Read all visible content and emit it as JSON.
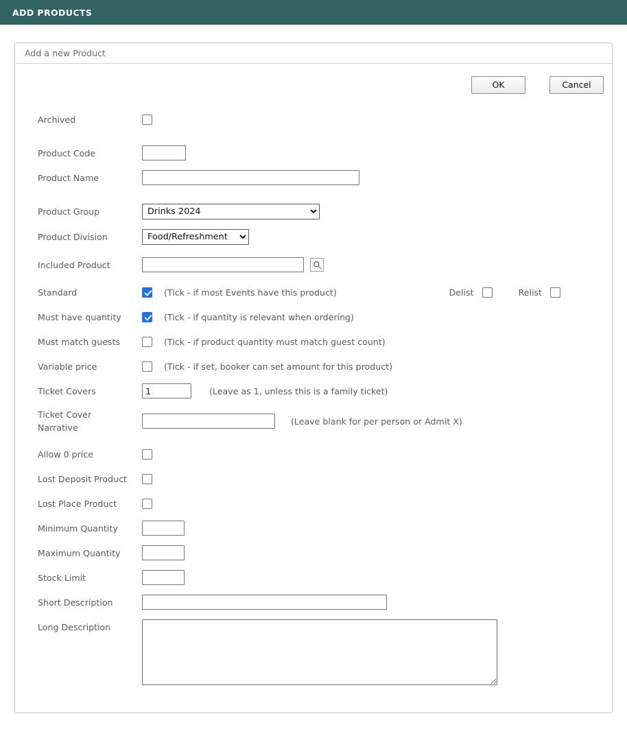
{
  "topbar": {
    "title": "ADD PRODUCTS"
  },
  "panel": {
    "heading": "Add a new Product"
  },
  "buttons": {
    "ok": "OK",
    "cancel": "Cancel"
  },
  "icons": {
    "search": "search-icon",
    "chevron_down": "chevron-down-icon"
  },
  "form": {
    "archived": {
      "label": "Archived",
      "checked": false
    },
    "product_code": {
      "label": "Product Code",
      "value": ""
    },
    "product_name": {
      "label": "Product Name",
      "value": ""
    },
    "product_group": {
      "label": "Product Group",
      "value": "Drinks 2024",
      "options": [
        "Drinks 2024"
      ]
    },
    "product_division": {
      "label": "Product Division",
      "value": "Food/Refreshment",
      "options": [
        "Food/Refreshment"
      ]
    },
    "included_product": {
      "label": "Included Product",
      "value": ""
    },
    "standard": {
      "label": "Standard",
      "checked": true,
      "hint": "(Tick - if most Events have this product)"
    },
    "delist": {
      "label": "Delist",
      "checked": false
    },
    "relist": {
      "label": "Relist",
      "checked": false
    },
    "must_have_quantity": {
      "label": "Must have quantity",
      "checked": true,
      "hint": "(Tick - if quantity is relevant when ordering)"
    },
    "must_match_guests": {
      "label": "Must match guests",
      "checked": false,
      "hint": "(Tick - if product quantity must match guest count)"
    },
    "variable_price": {
      "label": "Variable price",
      "checked": false,
      "hint": "(Tick - if set, booker can set amount for this product)"
    },
    "ticket_covers": {
      "label": "Ticket Covers",
      "value": "1",
      "hint": "(Leave as 1, unless this is a family ticket)"
    },
    "ticket_cover_narrative": {
      "label_line1": "Ticket Cover",
      "label_line2": "Narrative",
      "value": "",
      "hint": "(Leave blank for per person or Admit X)"
    },
    "allow_0_price": {
      "label": "Allow 0 price",
      "checked": false
    },
    "lost_deposit_product": {
      "label": "Lost Deposit Product",
      "checked": false
    },
    "lost_place_product": {
      "label": "Lost Place Product",
      "checked": false
    },
    "minimum_quantity": {
      "label": "Minimum Quantity",
      "value": ""
    },
    "maximum_quantity": {
      "label": "Maximum Quantity",
      "value": ""
    },
    "stock_limit": {
      "label": "Stock Limit",
      "value": ""
    },
    "short_description": {
      "label": "Short Description",
      "value": ""
    },
    "long_description": {
      "label": "Long Description",
      "value": ""
    }
  },
  "colors": {
    "header_bg": "#32635f",
    "checkbox_checked": "#1a73e8",
    "label_text": "#5a5a5a"
  }
}
